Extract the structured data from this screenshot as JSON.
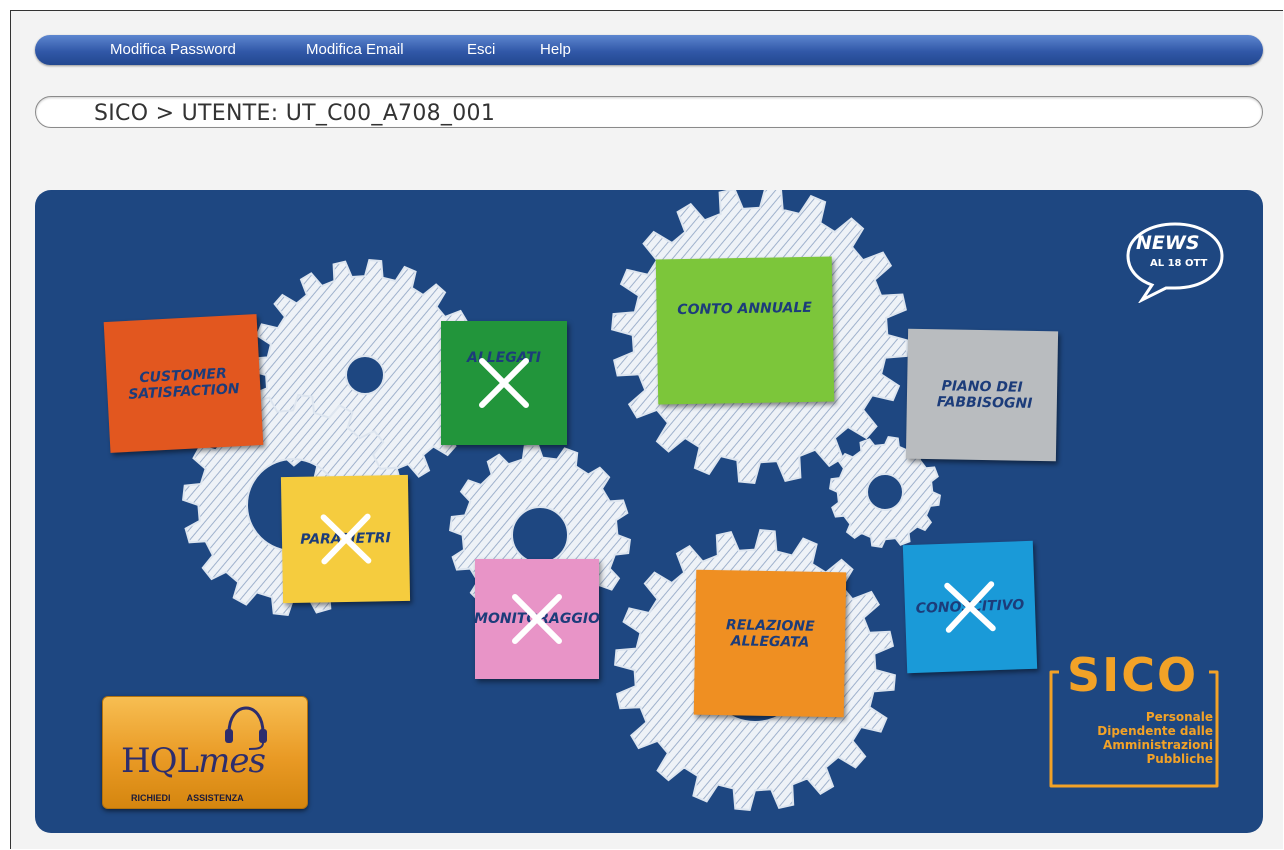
{
  "nav": {
    "items": [
      {
        "label": "Modifica Password"
      },
      {
        "label": "Modifica Email"
      },
      {
        "label": "Esci"
      },
      {
        "label": "Help"
      }
    ]
  },
  "breadcrumb": {
    "text": "SICO > UTENTE: UT_C00_A708_001"
  },
  "tiles": [
    {
      "label": "CUSTOMER SATISFACTION",
      "color": "#e2571f",
      "disabled": false
    },
    {
      "label": "ALLEGATI",
      "color": "#22953b",
      "disabled": true
    },
    {
      "label": "CONTO ANNUALE",
      "color": "#7cc63a",
      "disabled": false
    },
    {
      "label": "PIANO DEI FABBISOGNI",
      "color": "#b9bcbf",
      "disabled": false
    },
    {
      "label": "PARAMETRI",
      "color": "#f5cc3e",
      "disabled": true
    },
    {
      "label": "MONITORAGGIO",
      "color": "#e894c7",
      "disabled": true
    },
    {
      "label": "RELAZIONE ALLEGATA",
      "color": "#ef8f22",
      "disabled": false
    },
    {
      "label": "CONOSCITIVO",
      "color": "#1a9ad8",
      "disabled": true
    }
  ],
  "news": {
    "title": "NEWS",
    "date": "AL 18 OTT"
  },
  "support": {
    "name_part1": "HQL",
    "name_part2": "mes",
    "subtitle": "RICHIEDI ASSISTENZA"
  },
  "brand": {
    "name": "SICO",
    "description_lines": [
      "Personale",
      "Dipendente dalle",
      "Amministrazioni",
      "Pubbliche"
    ]
  },
  "icons": {
    "news": "speech-bubble-icon",
    "support": "headset-icon",
    "disabled": "x-mark-icon"
  },
  "colors": {
    "nav": "#3158a8",
    "board": "#1e4781",
    "brand": "#f2a227"
  }
}
